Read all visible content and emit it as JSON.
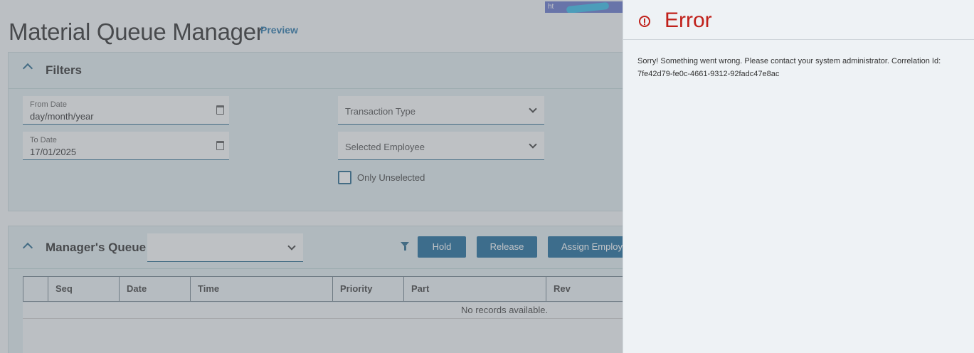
{
  "app": {
    "title": "Material Queue Manager",
    "preview": "Preview",
    "url_fragment": "ht"
  },
  "filters": {
    "title": "Filters",
    "from_date": {
      "label": "From Date",
      "value": "day/month/year"
    },
    "to_date": {
      "label": "To Date",
      "value": "17/01/2025"
    },
    "transaction_type": "Transaction Type",
    "selected_employee": "Selected Employee",
    "only_unselected": "Only Unselected"
  },
  "queue": {
    "title": "Manager's Queue",
    "select_value": "",
    "hold": "Hold",
    "release": "Release",
    "assign": "Assign Employ",
    "columns": [
      "Seq",
      "Date",
      "Time",
      "Priority",
      "Part",
      "Rev"
    ],
    "no_records": "No records available."
  },
  "error": {
    "title": "Error",
    "message": "Sorry! Something went wrong. Please contact your system administrator. Correlation Id: 7fe42d79-fe0c-4661-9312-92fadc47e8ac"
  },
  "colors": {
    "accent": "#0d6194",
    "error": "#c0211b"
  }
}
